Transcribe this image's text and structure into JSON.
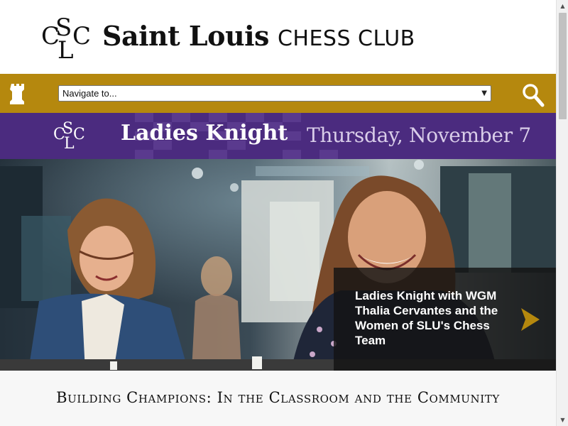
{
  "header": {
    "logo_text": "CSLC",
    "brand": "Saint Louis",
    "sub": "CHESS CLUB"
  },
  "nav": {
    "select_value": "Navigate to...",
    "icons": [
      "rook-icon",
      "search-icon",
      "chevron-down-icon"
    ]
  },
  "banner": {
    "title": "Ladies Knight",
    "date": "Thursday, November 7"
  },
  "hero": {
    "caption": "Ladies Knight with WGM Thalia Cervantes and the Women of SLU's Chess Team",
    "arrow_icon": "chevron-right-icon"
  },
  "tagline": "Building Champions: In the Classroom and the Community",
  "colors": {
    "gold": "#b5880e",
    "purple": "#4b2b7f",
    "caption_bg": "#141414"
  }
}
